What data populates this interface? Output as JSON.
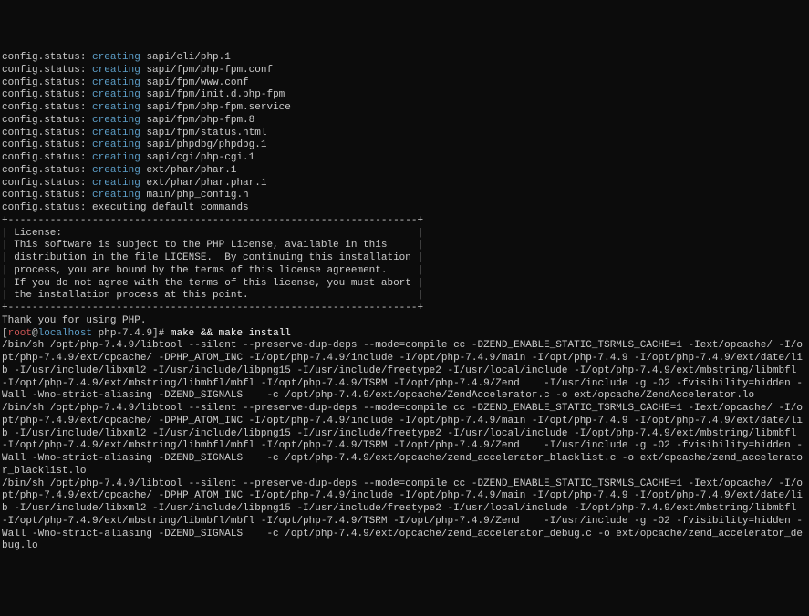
{
  "config_status": [
    {
      "prefix": "config.status: ",
      "action": "creating",
      "target": " sapi/cli/php.1"
    },
    {
      "prefix": "config.status: ",
      "action": "creating",
      "target": " sapi/fpm/php-fpm.conf"
    },
    {
      "prefix": "config.status: ",
      "action": "creating",
      "target": " sapi/fpm/www.conf"
    },
    {
      "prefix": "config.status: ",
      "action": "creating",
      "target": " sapi/fpm/init.d.php-fpm"
    },
    {
      "prefix": "config.status: ",
      "action": "creating",
      "target": " sapi/fpm/php-fpm.service"
    },
    {
      "prefix": "config.status: ",
      "action": "creating",
      "target": " sapi/fpm/php-fpm.8"
    },
    {
      "prefix": "config.status: ",
      "action": "creating",
      "target": " sapi/fpm/status.html"
    },
    {
      "prefix": "config.status: ",
      "action": "creating",
      "target": " sapi/phpdbg/phpdbg.1"
    },
    {
      "prefix": "config.status: ",
      "action": "creating",
      "target": " sapi/cgi/php-cgi.1"
    },
    {
      "prefix": "config.status: ",
      "action": "creating",
      "target": " ext/phar/phar.1"
    },
    {
      "prefix": "config.status: ",
      "action": "creating",
      "target": " ext/phar/phar.phar.1"
    },
    {
      "prefix": "config.status: ",
      "action": "creating",
      "target": " main/php_config.h"
    },
    {
      "prefix": "config.status: executing default commands",
      "action": "",
      "target": ""
    }
  ],
  "license_box": {
    "hr": "+--------------------------------------------------------------------+",
    "lines": [
      "| License:                                                           |",
      "| This software is subject to the PHP License, available in this     |",
      "| distribution in the file LICENSE.  By continuing this installation |",
      "| process, you are bound by the terms of this license agreement.     |",
      "| If you do not agree with the terms of this license, you must abort |",
      "| the installation process at this point.                            |"
    ]
  },
  "thanks": "Thank you for using PHP.",
  "prompt": {
    "open": "[",
    "user": "root",
    "at": "@",
    "host": "localhost",
    "dir": " php-7.4.9]# ",
    "cmd": "make && make install"
  },
  "compile_output": [
    "/bin/sh /opt/php-7.4.9/libtool --silent --preserve-dup-deps --mode=compile cc -DZEND_ENABLE_STATIC_TSRMLS_CACHE=1 -Iext/opcache/ -I/opt/php-7.4.9/ext/opcache/ -DPHP_ATOM_INC -I/opt/php-7.4.9/include -I/opt/php-7.4.9/main -I/opt/php-7.4.9 -I/opt/php-7.4.9/ext/date/lib -I/usr/include/libxml2 -I/usr/include/libpng15 -I/usr/include/freetype2 -I/usr/local/include -I/opt/php-7.4.9/ext/mbstring/libmbfl -I/opt/php-7.4.9/ext/mbstring/libmbfl/mbfl -I/opt/php-7.4.9/TSRM -I/opt/php-7.4.9/Zend    -I/usr/include -g -O2 -fvisibility=hidden -Wall -Wno-strict-aliasing -DZEND_SIGNALS    -c /opt/php-7.4.9/ext/opcache/ZendAccelerator.c -o ext/opcache/ZendAccelerator.lo",
    "/bin/sh /opt/php-7.4.9/libtool --silent --preserve-dup-deps --mode=compile cc -DZEND_ENABLE_STATIC_TSRMLS_CACHE=1 -Iext/opcache/ -I/opt/php-7.4.9/ext/opcache/ -DPHP_ATOM_INC -I/opt/php-7.4.9/include -I/opt/php-7.4.9/main -I/opt/php-7.4.9 -I/opt/php-7.4.9/ext/date/lib -I/usr/include/libxml2 -I/usr/include/libpng15 -I/usr/include/freetype2 -I/usr/local/include -I/opt/php-7.4.9/ext/mbstring/libmbfl -I/opt/php-7.4.9/ext/mbstring/libmbfl/mbfl -I/opt/php-7.4.9/TSRM -I/opt/php-7.4.9/Zend    -I/usr/include -g -O2 -fvisibility=hidden -Wall -Wno-strict-aliasing -DZEND_SIGNALS    -c /opt/php-7.4.9/ext/opcache/zend_accelerator_blacklist.c -o ext/opcache/zend_accelerator_blacklist.lo",
    "/bin/sh /opt/php-7.4.9/libtool --silent --preserve-dup-deps --mode=compile cc -DZEND_ENABLE_STATIC_TSRMLS_CACHE=1 -Iext/opcache/ -I/opt/php-7.4.9/ext/opcache/ -DPHP_ATOM_INC -I/opt/php-7.4.9/include -I/opt/php-7.4.9/main -I/opt/php-7.4.9 -I/opt/php-7.4.9/ext/date/lib -I/usr/include/libxml2 -I/usr/include/libpng15 -I/usr/include/freetype2 -I/usr/local/include -I/opt/php-7.4.9/ext/mbstring/libmbfl -I/opt/php-7.4.9/ext/mbstring/libmbfl/mbfl -I/opt/php-7.4.9/TSRM -I/opt/php-7.4.9/Zend    -I/usr/include -g -O2 -fvisibility=hidden -Wall -Wno-strict-aliasing -DZEND_SIGNALS    -c /opt/php-7.4.9/ext/opcache/zend_accelerator_debug.c -o ext/opcache/zend_accelerator_debug.lo"
  ]
}
